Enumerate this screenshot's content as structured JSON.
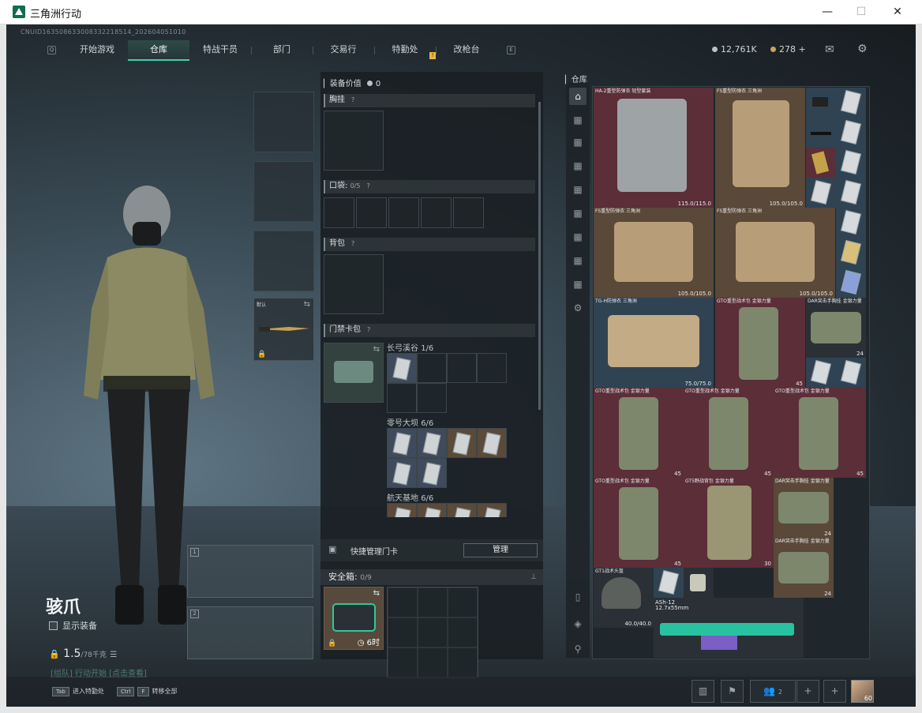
{
  "window": {
    "title": "三角洲行动",
    "min": "—",
    "max": "☐",
    "close": "✕"
  },
  "uid": "CNUID163508633008332218514_202604051010",
  "nav": {
    "tabs": [
      {
        "label": "开始游戏",
        "active": false
      },
      {
        "label": "仓库",
        "active": true
      },
      {
        "label": "特战干员",
        "active": false
      },
      {
        "label": "部门",
        "active": false
      },
      {
        "label": "交易行",
        "active": false
      },
      {
        "label": "特勤处",
        "active": false
      },
      {
        "label": "改枪台",
        "active": false
      }
    ],
    "left_key": "Q",
    "right_key": "E",
    "notification": "!"
  },
  "currency": {
    "coins": "12,761K",
    "premium": "278 +"
  },
  "character": {
    "name": "骇爪",
    "show_equipment": "显示装备",
    "weight": "1.5",
    "weight_max": "/78千克",
    "team_hint": "[组队] 行动开始 [点击查看]"
  },
  "gear": {
    "melee_label": "默认"
  },
  "gun_slots": [
    "1",
    "2"
  ],
  "mid": {
    "equip_value_label": "装备价值",
    "equip_value": "0",
    "chest_label": "胸挂",
    "pocket_label": "口袋:",
    "pocket_count": "0/5",
    "backpack_label": "背包",
    "keycard_label": "门禁卡包",
    "maps": [
      {
        "name": "长弓溪谷",
        "count": "1/6"
      },
      {
        "name": "零号大坝",
        "count": "6/6"
      },
      {
        "name": "航天基地",
        "count": "6/6"
      }
    ],
    "quick_manage": "快捷管理门卡",
    "manage_btn": "管理",
    "safe_label": "安全箱:",
    "safe_count": "0/9",
    "safe_timer": "6时"
  },
  "storage": {
    "label": "仓库",
    "items": [
      {
        "name": "HA-2重型防弹衣 轻型套装",
        "durability": "115.0/115.0"
      },
      {
        "name": "FS重型防弹衣 三角洲",
        "durability": "105.0/105.0"
      },
      {
        "name": "FS重型防弹衣 三角洲",
        "durability": "105.0/105.0"
      },
      {
        "name": "FS重型防弹衣 三角洲",
        "durability": "105.0/105.0"
      },
      {
        "name": "TG-H防弹衣 三角洲",
        "durability": "75.0/75.0"
      },
      {
        "name": "GTO重型战术包 金银力量",
        "capacity": "45"
      },
      {
        "name": "DAR突击手胸挂 金银力量",
        "capacity": "24"
      },
      {
        "name": "GTO重型战术包 金银力量",
        "capacity": "45"
      },
      {
        "name": "GTO重型战术包 金银力量",
        "capacity": "45"
      },
      {
        "name": "GTO重型战术包 金银力量",
        "capacity": "45"
      },
      {
        "name": "GTO重型战术包 金银力量",
        "capacity": "45"
      },
      {
        "name": "GT5野战背包 金银力量",
        "capacity": "30"
      },
      {
        "name": "DAR突击手胸挂 金银力量",
        "capacity": "24"
      },
      {
        "name": "DAR突击手胸挂 金银力量",
        "capacity": "24"
      },
      {
        "name": "GT1战术头盔",
        "durability": "40.0/40.0"
      },
      {
        "name": "ASh-12",
        "caliber": "12.7x55mm"
      }
    ]
  },
  "bottom": {
    "tab_key": "Tab",
    "tab_label": "进入特勤处",
    "ctrl_key": "Ctrl",
    "f_key": "F",
    "ctrl_label": "转移全部",
    "squad_count": "2",
    "level": "60"
  }
}
